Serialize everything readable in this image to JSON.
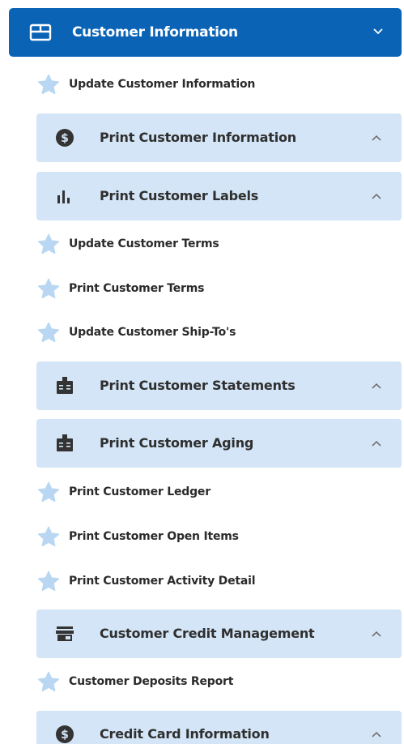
{
  "header": {
    "label": "Customer Information",
    "icon": "book-open-icon",
    "chevron": "chevron-down-icon",
    "background": "#0a63b5"
  },
  "colors": {
    "group_background": "#d3e5f6",
    "star": "#b9d7f2",
    "text": "#2b2b2b"
  },
  "items": [
    {
      "type": "leaf",
      "label": "Update Customer Information",
      "icon": "star-icon"
    },
    {
      "type": "group",
      "label": "Print Customer Information",
      "icon": "dollar-circle-icon",
      "chevron": "chevron-up-icon"
    },
    {
      "type": "group",
      "label": "Print Customer Labels",
      "icon": "bar-chart-icon",
      "chevron": "chevron-up-icon"
    },
    {
      "type": "leaf",
      "label": "Update Customer Terms",
      "icon": "star-icon"
    },
    {
      "type": "leaf",
      "label": "Print Customer Terms",
      "icon": "star-icon"
    },
    {
      "type": "leaf",
      "label": "Update Customer Ship-To's",
      "icon": "star-icon"
    },
    {
      "type": "group",
      "label": "Print Customer Statements",
      "icon": "id-badge-icon",
      "chevron": "chevron-up-icon"
    },
    {
      "type": "group",
      "label": "Print Customer Aging",
      "icon": "id-badge-icon",
      "chevron": "chevron-up-icon"
    },
    {
      "type": "leaf",
      "label": "Print Customer Ledger",
      "icon": "star-icon"
    },
    {
      "type": "leaf",
      "label": "Print Customer Open Items",
      "icon": "star-icon"
    },
    {
      "type": "leaf",
      "label": "Print Customer Activity Detail",
      "icon": "star-icon"
    },
    {
      "type": "group",
      "label": "Customer Credit Management",
      "icon": "store-icon",
      "chevron": "chevron-up-icon"
    },
    {
      "type": "leaf",
      "label": "Customer Deposits Report",
      "icon": "star-icon"
    },
    {
      "type": "group",
      "label": "Credit Card Information",
      "icon": "dollar-circle-icon",
      "chevron": "chevron-up-icon"
    }
  ]
}
